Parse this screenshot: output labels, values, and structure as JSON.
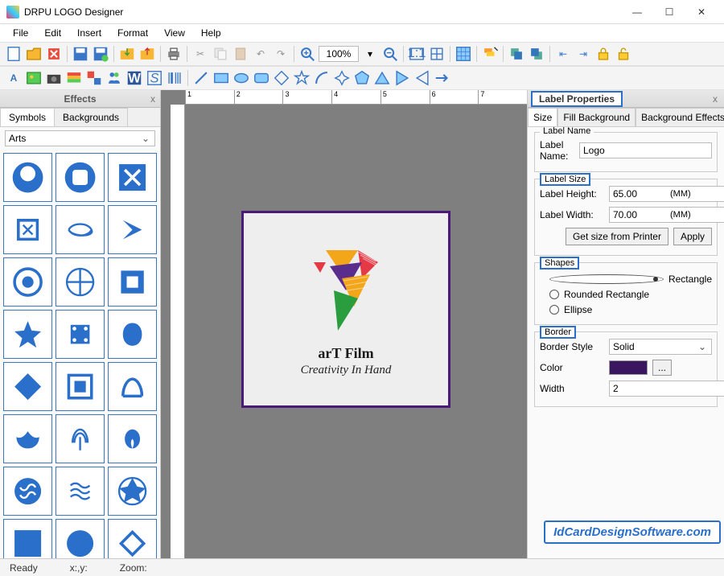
{
  "window": {
    "title": "DRPU LOGO Designer"
  },
  "menu": {
    "file": "File",
    "edit": "Edit",
    "insert": "Insert",
    "format": "Format",
    "view": "View",
    "help": "Help"
  },
  "toolbar": {
    "zoom": "100%"
  },
  "effects": {
    "title": "Effects",
    "tabs": {
      "symbols": "Symbols",
      "backgrounds": "Backgrounds"
    },
    "category": "Arts"
  },
  "ruler": {
    "marks": [
      "1",
      "2",
      "3",
      "4",
      "5",
      "6",
      "7"
    ]
  },
  "canvas": {
    "logoText1": "arT Film",
    "logoText2": "Creativity In Hand"
  },
  "props": {
    "title": "Label Properties",
    "tabs": {
      "size": "Size",
      "fill": "Fill Background",
      "bgfx": "Background Effects"
    },
    "labelNameGroup": "Label Name",
    "labelNameLbl": "Label Name:",
    "labelNameVal": "Logo",
    "sizeGroup": "Label Size",
    "heightLbl": "Label Height:",
    "heightVal": "65.00",
    "widthLbl": "Label Width:",
    "widthVal": "70.00",
    "unit": "(MM)",
    "getSizeBtn": "Get size from Printer",
    "applyBtn": "Apply",
    "shapesGroup": "Shapes",
    "shapeRect": "Rectangle",
    "shapeRound": "Rounded Rectangle",
    "shapeEllipse": "Ellipse",
    "borderGroup": "Border",
    "borderStyleLbl": "Border Style",
    "borderStyleVal": "Solid",
    "colorLbl": "Color",
    "colorMore": "...",
    "widthLbl2": "Width",
    "widthVal2": "2"
  },
  "status": {
    "ready": "Ready",
    "xy": "x:,y:",
    "zoom": "Zoom:"
  },
  "watermark": "IdCardDesignSoftware.com"
}
